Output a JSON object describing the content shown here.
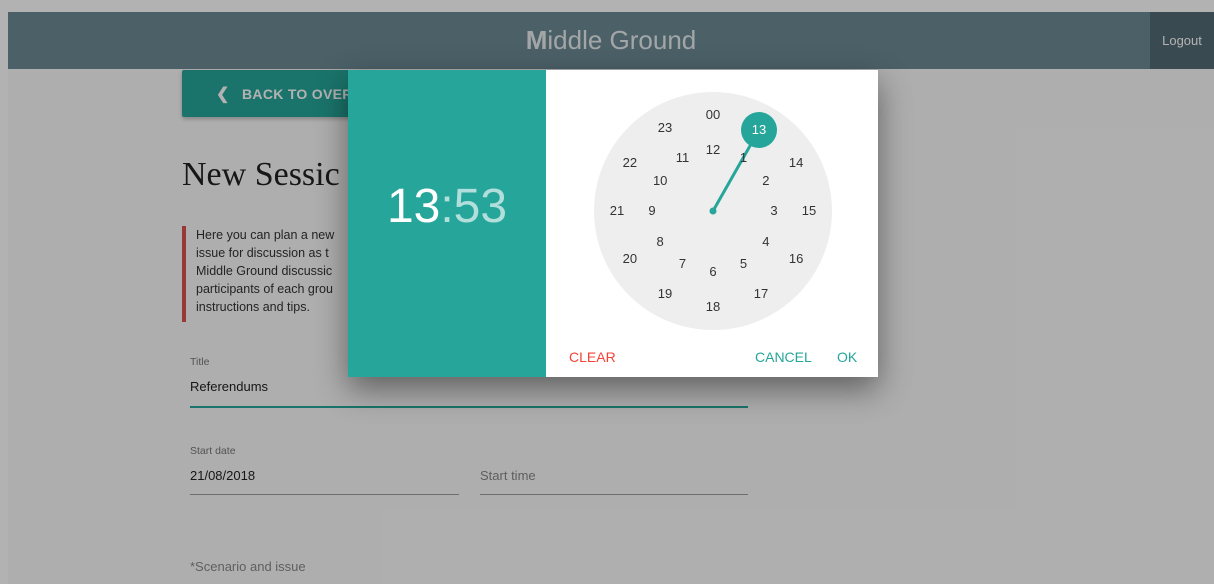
{
  "header": {
    "brand_first": "M",
    "brand_rest": "iddle Ground",
    "logout_label": "Logout"
  },
  "back_button": {
    "icon": "chevron-left-icon",
    "label": "BACK TO OVER"
  },
  "page_title": "New Sessic",
  "notice": {
    "text": "Here you can plan a new\nissue for discussion as t\nMiddle Ground discussic\nparticipants of each grou\ninstructions and tips."
  },
  "form": {
    "title": {
      "label": "Title",
      "value": "Referendums"
    },
    "start_date": {
      "label": "Start date",
      "value": "21/08/2018"
    },
    "start_time": {
      "placeholder": "Start time"
    },
    "scenario": {
      "label": "*Scenario and issue"
    }
  },
  "time_picker": {
    "hour": "13",
    "colon": ":",
    "minute": "53",
    "selected_hour": "13",
    "outer_hours": [
      "00",
      "13",
      "14",
      "15",
      "16",
      "17",
      "18",
      "19",
      "20",
      "21",
      "22",
      "23"
    ],
    "inner_hours": [
      "12",
      "1",
      "2",
      "3",
      "4",
      "5",
      "6",
      "7",
      "8",
      "9",
      "10",
      "11"
    ],
    "clear_label": "CLEAR",
    "cancel_label": "CANCEL",
    "ok_label": "OK",
    "accent_color": "#26a69a",
    "clear_color": "#f44336"
  }
}
